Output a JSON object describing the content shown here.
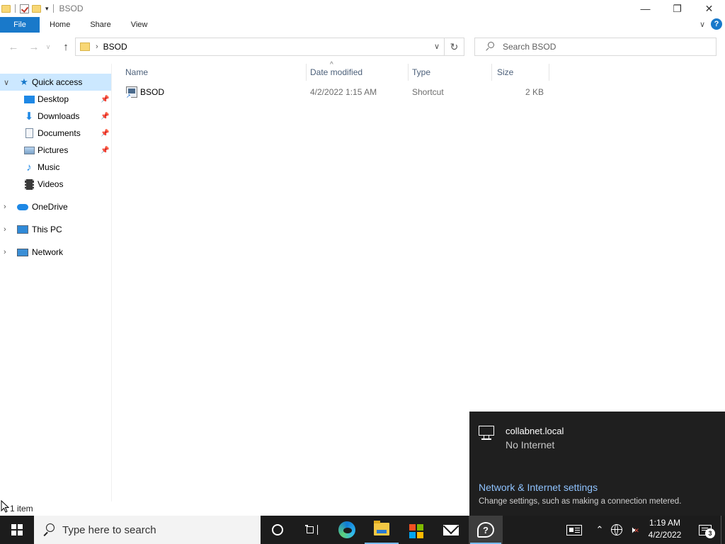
{
  "window": {
    "title": "BSOD",
    "controls": {
      "minimize": "—",
      "restore": "❐",
      "close": "✕"
    }
  },
  "ribbon": {
    "tabs": [
      "File",
      "Home",
      "Share",
      "View"
    ]
  },
  "address": {
    "breadcrumb_sep": "›",
    "path": "BSOD",
    "search_placeholder": "Search BSOD"
  },
  "nav_pane": {
    "quick_access": "Quick access",
    "items": [
      {
        "label": "Desktop",
        "icon": "desktop-icon",
        "pinned": true
      },
      {
        "label": "Downloads",
        "icon": "download-icon",
        "pinned": true
      },
      {
        "label": "Documents",
        "icon": "documents-icon",
        "pinned": true
      },
      {
        "label": "Pictures",
        "icon": "pictures-icon",
        "pinned": true
      },
      {
        "label": "Music",
        "icon": "music-icon",
        "pinned": false
      },
      {
        "label": "Videos",
        "icon": "videos-icon",
        "pinned": false
      }
    ],
    "roots": [
      {
        "label": "OneDrive",
        "icon": "onedrive-icon"
      },
      {
        "label": "This PC",
        "icon": "computer-icon"
      },
      {
        "label": "Network",
        "icon": "network-icon"
      }
    ]
  },
  "file_list": {
    "columns": [
      "Name",
      "Date modified",
      "Type",
      "Size"
    ],
    "rows": [
      {
        "name": "BSOD",
        "date_modified": "4/2/2022 1:15 AM",
        "type": "Shortcut",
        "size": "2 KB",
        "icon": "shortcut-icon"
      }
    ]
  },
  "status": {
    "item_count": "1 item"
  },
  "network_flyout": {
    "network_name": "collabnet.local",
    "network_status": "No Internet",
    "settings_link": "Network & Internet settings",
    "settings_desc": "Change settings, such as making a connection metered."
  },
  "taskbar": {
    "search_placeholder": "Type here to search",
    "apps": [
      "cortana-icon",
      "task-view-icon",
      "edge-icon",
      "file-explorer-icon",
      "store-icon",
      "mail-icon",
      "get-help-icon"
    ],
    "tray": [
      "news-icon",
      "chevron-up-icon",
      "network-globe-icon",
      "volume-muted-icon"
    ],
    "time": "1:19 AM",
    "date": "4/2/2022",
    "notification_count": "3"
  },
  "colors": {
    "accent": "#1979ca",
    "selection": "#cce8ff",
    "taskbar": "#1c1c1c",
    "flyout_bg": "#1f1f1f",
    "link": "#8fc3ff"
  }
}
